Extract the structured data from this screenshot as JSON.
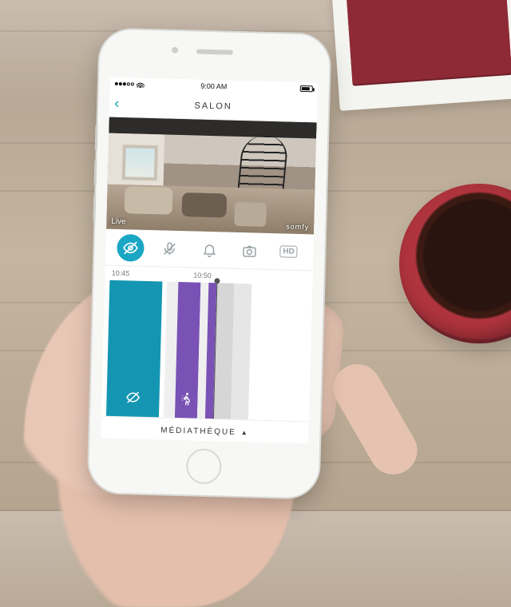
{
  "statusbar": {
    "carrier": "",
    "time": "9:00 AM",
    "battery": ""
  },
  "header": {
    "back_glyph": "‹",
    "title": "SALON"
  },
  "feed": {
    "live_label": "Live",
    "brand_label": "somfy"
  },
  "toolbar": {
    "privacy": "privacy",
    "mic": "mic-off",
    "bell": "bell",
    "camera": "camera",
    "hd": "HD"
  },
  "timestamps": {
    "t1": "10:45",
    "t2": "10:50"
  },
  "timeline": {
    "event1_icon": "privacy",
    "event2_icon": "motion"
  },
  "media": {
    "label": "MÉDIATHÈQUE",
    "caret": "▲"
  }
}
